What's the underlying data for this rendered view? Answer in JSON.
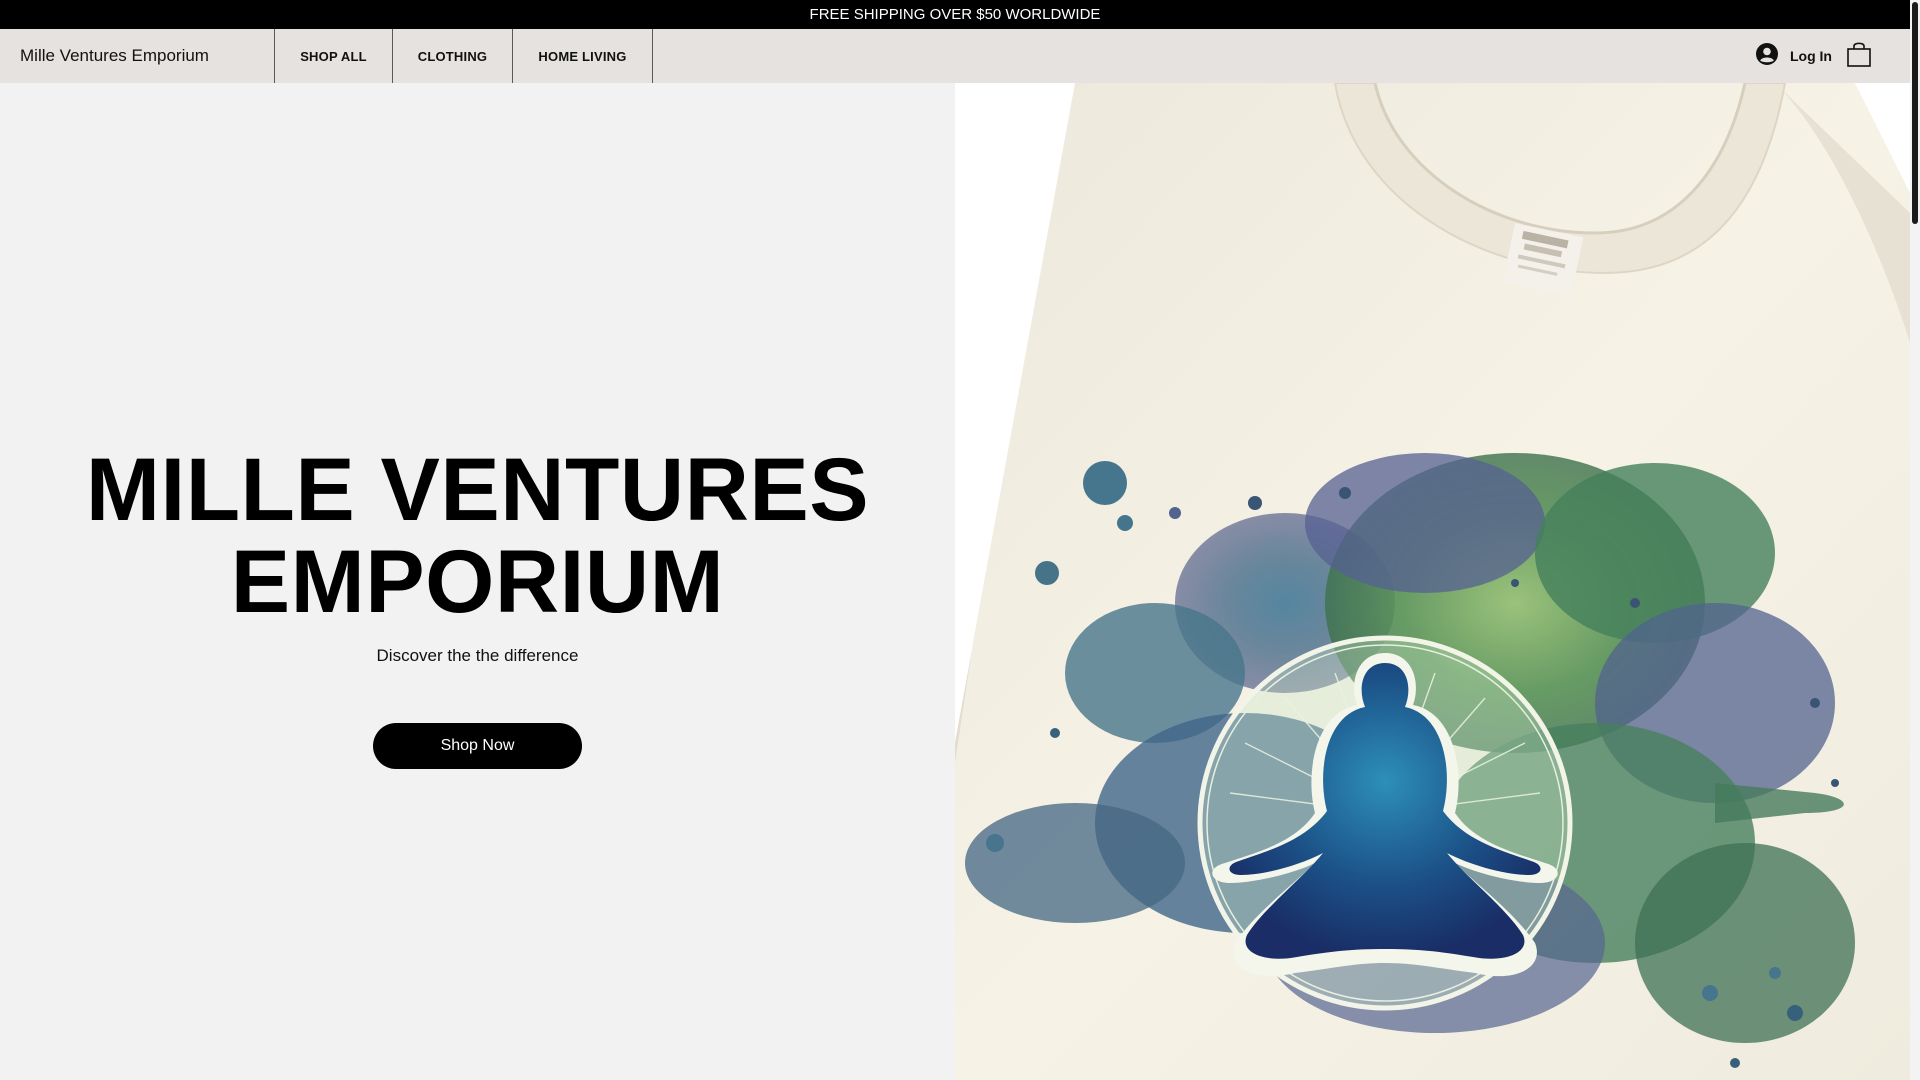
{
  "announcement": {
    "text": "FREE SHIPPING OVER $50 WORLDWIDE"
  },
  "header": {
    "brand": "Mille Ventures Emporium",
    "nav": [
      {
        "label": "SHOP ALL"
      },
      {
        "label": "CLOTHING"
      },
      {
        "label": "HOME LIVING"
      }
    ],
    "login_label": "Log In",
    "icons": {
      "login": "user-avatar-icon",
      "cart": "shopping-bag-icon"
    }
  },
  "hero": {
    "title_line1": "MILLE VENTURES",
    "title_line2": "EMPORIUM",
    "subtitle": "Discover the the difference",
    "cta_label": "Shop Now",
    "image": "cream t-shirt with watercolor meditation figure print"
  },
  "colors": {
    "announcement_bg": "#000000",
    "header_bg": "#e5e2df",
    "hero_bg": "#f2f2f2",
    "cta_bg": "#000000",
    "cta_text": "#ffffff"
  }
}
